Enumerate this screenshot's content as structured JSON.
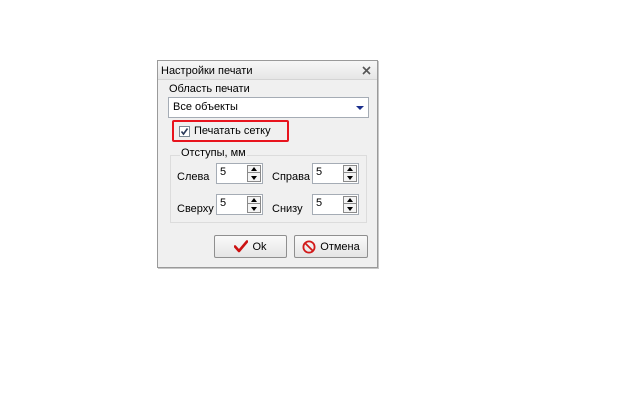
{
  "dialog": {
    "title": "Настройки печати",
    "print_area_label": "Область печати",
    "print_area_value": "Все объекты",
    "print_grid_label": "Печатать сетку",
    "print_grid_checked": true,
    "margins_label": "Отступы, мм",
    "margins": {
      "left_label": "Слева",
      "left_value": "5",
      "right_label": "Справа",
      "right_value": "5",
      "top_label": "Сверху",
      "top_value": "5",
      "bottom_label": "Снизу",
      "bottom_value": "5"
    },
    "ok_label": "Ok",
    "cancel_label": "Отмена"
  },
  "colors": {
    "highlight_box": "#e8141e",
    "ok_check": "#cc1111",
    "cancel_icon": "#d21a1a"
  },
  "icons": {
    "close": "close-icon",
    "dropdown": "chevron-down-icon",
    "check": "checkmark-icon",
    "ok": "red-checkmark-icon",
    "cancel": "no-entry-icon"
  }
}
